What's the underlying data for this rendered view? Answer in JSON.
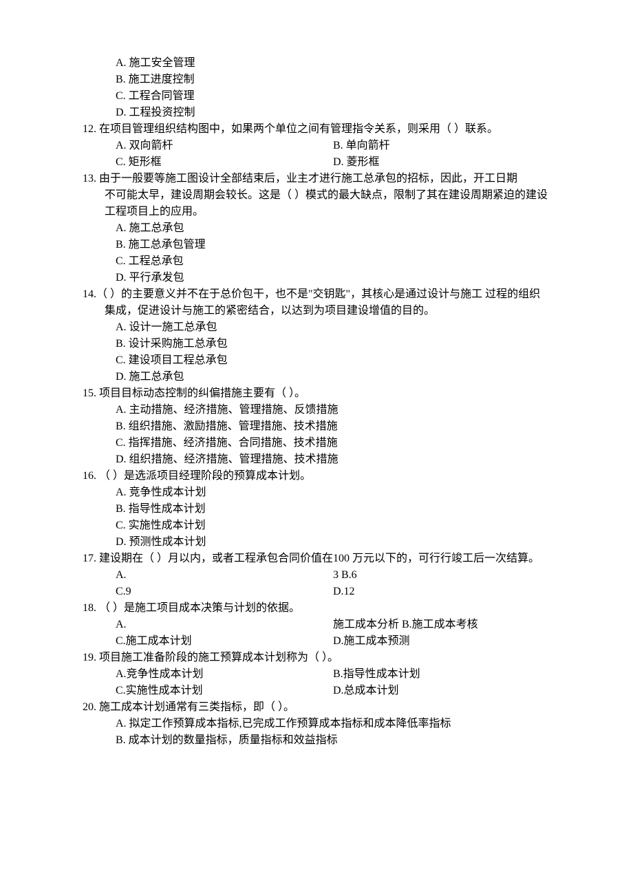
{
  "q11": {
    "optA": "A. 施工安全管理",
    "optB": "B. 施工进度控制",
    "optC": "C. 工程合同管理",
    "optD": "D. 工程投资控制"
  },
  "q12": {
    "stem": "12. 在项目管理组织结构图中，如果两个单位之间有管理指令关系，则采用（  ）联系。",
    "optA": "A. 双向箭杆",
    "optB": "B.  单向箭杆",
    "optC": "C. 矩形框",
    "optD": "D. 菱形框"
  },
  "q13": {
    "stem1": "13. 由于一般要等施工图设计全部结束后，业主才进行施工总承包的招标，因此，开工日期",
    "stem2": "不可能太早，建设周期会较长。这是（  ）模式的最大缺点，限制了其在建设周期紧迫的建设工程项目上的应用。",
    "optA": "A. 施工总承包",
    "optB": "B. 施工总承包管理",
    "optC": "C. 工程总承包",
    "optD": "D. 平行承发包"
  },
  "q14": {
    "stem": "14.（ ）的主要意义并不在于总价包干，也不是\"交钥匙\"，其核心是通过设计与施工 过程的组织集成，促进设计与施工的紧密结合，以达到为项目建设增值的目的。",
    "optA": "A. 设计一施工总承包",
    "optB": "B. 设计采购施工总承包",
    "optC": "C. 建设项目工程总承包",
    "optD": "D. 施工总承包"
  },
  "q15": {
    "stem": "15. 项目目标动态控制的纠偏措施主要有（ ）。",
    "optA": "A. 主动措施、经济措施、管理措施、反馈措施",
    "optB": "B. 组织措施、激励措施、管理措施、技术措施",
    "optC": "C. 指挥措施、经济措施、合同措施、技术措施",
    "optD": "D. 组织措施、经济措施、管理措施、技术措施"
  },
  "q16": {
    "stem": "16. （ ）是选派项目经理阶段的预算成本计划。",
    "optA": "A. 竞争性成本计划",
    "optB": "B. 指导性成本计划",
    "optC": "C. 实施性成本计划",
    "optD": "D. 预测性成本计划"
  },
  "q17": {
    "stem": "17.  建设期在（  ）月以内，或者工程承包合同价值在100 万元以下的，可行行竣工后一次结算。",
    "optA": "A.",
    "optA2": "3    B.6",
    "optC": "C.9",
    "optD": "D.12"
  },
  "q18": {
    "stem": "18.  （ ）是施工项目成本决策与计划的依据。",
    "optA": "A.",
    "optA2": "施工成本分析  B.施工成本考核",
    "optC": "C.施工成本计划",
    "optD": "D.施工成本预测"
  },
  "q19": {
    "stem": "19.  项目施工准备阶段的施工预算成本计划称为（ ）。",
    "optA": "A.竞争性成本计划",
    "optB": "B.指导性成本计划",
    "optC": "C.实施性成本计划",
    "optD": "D.总成本计划"
  },
  "q20": {
    "stem": "20.  施工成本计划通常有三类指标，即（  ）。",
    "optA": "A. 拟定工作预算成本指标,已完成工作预算成本指标和成本降低率指标",
    "optB": "B. 成本计划的数量指标，质量指标和效益指标"
  }
}
